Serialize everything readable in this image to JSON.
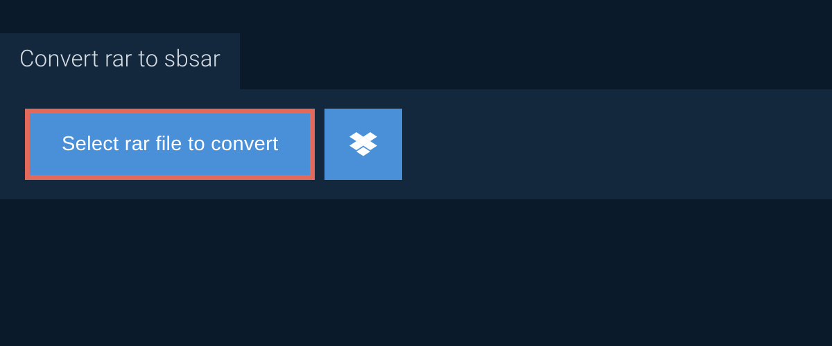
{
  "header": {
    "title": "Convert rar to sbsar"
  },
  "upload": {
    "select_label": "Select rar file to convert",
    "dropbox_icon": "dropbox"
  },
  "colors": {
    "background_dark": "#0a1a2a",
    "panel": "#13273d",
    "button_blue": "#4a90d9",
    "highlight_border": "#e36a5b",
    "text_light": "#d5dde4"
  }
}
